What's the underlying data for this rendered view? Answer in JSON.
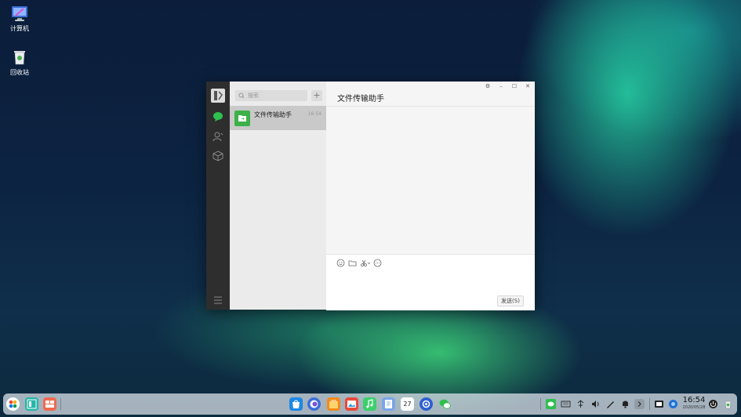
{
  "desktop": {
    "computer_label": "计算机",
    "trash_label": "回收站"
  },
  "window": {
    "search_placeholder": "搜索",
    "add_label": "+",
    "chat_list": [
      {
        "name": "文件传输助手",
        "time": "16:54"
      }
    ],
    "chat_title": "文件传输助手",
    "send_label": "发送(S)",
    "controls": {
      "settings": "⚙",
      "minimize": "–",
      "maximize": "☐",
      "close": "✕"
    }
  },
  "taskbar": {
    "time": "16:54",
    "date": "2020/05/28",
    "calendar_day": "27"
  }
}
